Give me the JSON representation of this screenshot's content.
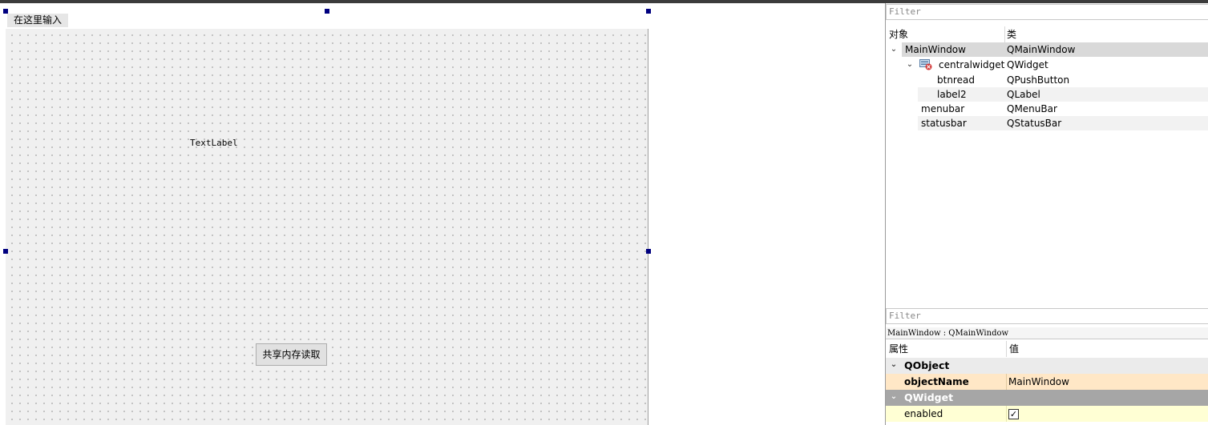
{
  "form": {
    "menubar_entry": "在这里输入",
    "text_label": "TextLabel",
    "push_button": "共享内存读取"
  },
  "object_inspector": {
    "filter_placeholder": "Filter",
    "col_object": "对象",
    "col_class": "类",
    "rows": [
      {
        "name": "MainWindow",
        "class": "QMainWindow"
      },
      {
        "name": "centralwidget",
        "class": "QWidget"
      },
      {
        "name": "btnread",
        "class": "QPushButton"
      },
      {
        "name": "label2",
        "class": "QLabel"
      },
      {
        "name": "menubar",
        "class": "QMenuBar"
      },
      {
        "name": "statusbar",
        "class": "QStatusBar"
      }
    ]
  },
  "property_editor": {
    "filter_placeholder": "Filter",
    "object_title": "MainWindow : QMainWindow",
    "col_property": "属性",
    "col_value": "值",
    "groups": [
      {
        "name": "QObject",
        "color": "#ebebeb"
      },
      {
        "name": "QWidget",
        "color": "#a6a6a6"
      }
    ],
    "props": [
      {
        "name": "objectName",
        "value": "MainWindow",
        "color": "#ffe7c6"
      },
      {
        "name": "enabled",
        "checked": true,
        "color": "#ffffd4"
      }
    ]
  },
  "icons": {
    "expand": "chevron-down-icon",
    "widget": "widget-icon"
  },
  "colors": {
    "selection_handle": "#00007f",
    "selected_row": "#d9d9d9",
    "alt_row": "#f2f2f2"
  }
}
